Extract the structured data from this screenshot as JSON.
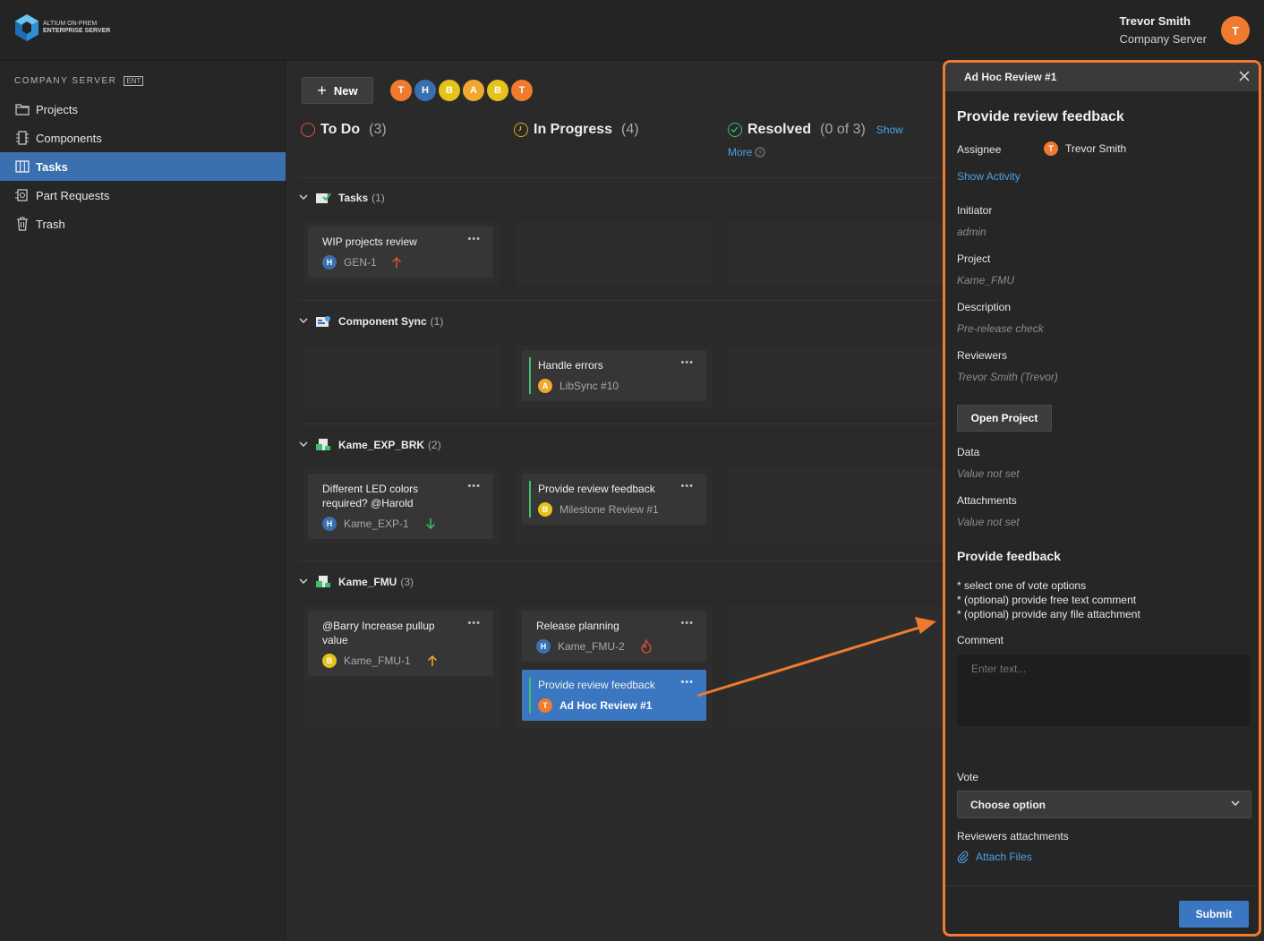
{
  "app": {
    "logo_line1": "ALTIUM ON-PREM",
    "logo_line2": "ENTERPRISE SERVER"
  },
  "user": {
    "name": "Trevor Smith",
    "server": "Company Server",
    "initial": "T"
  },
  "sidebar": {
    "header": "COMPANY SERVER",
    "badge": "ENT",
    "items": [
      {
        "label": "Projects",
        "icon": "folder-icon"
      },
      {
        "label": "Components",
        "icon": "component-icon"
      },
      {
        "label": "Tasks",
        "icon": "board-icon",
        "active": true
      },
      {
        "label": "Part Requests",
        "icon": "part-request-icon"
      },
      {
        "label": "Trash",
        "icon": "trash-icon"
      }
    ]
  },
  "board": {
    "new_label": "New",
    "filter_avatars": [
      {
        "initial": "T",
        "color": "#f07a2e"
      },
      {
        "initial": "H",
        "color": "#3a6fb0"
      },
      {
        "initial": "B",
        "color": "#e6c21a"
      },
      {
        "initial": "A",
        "color": "#f0a830"
      },
      {
        "initial": "B",
        "color": "#e6c21a"
      },
      {
        "initial": "T",
        "color": "#f07a2e"
      }
    ],
    "columns": [
      {
        "title": "To Do",
        "count": "(3)"
      },
      {
        "title": "In Progress",
        "count": "(4)"
      },
      {
        "title": "Resolved",
        "count": "(0 of 3)",
        "link1": "Show",
        "link2": "More"
      }
    ],
    "groups": [
      {
        "name": "Tasks",
        "count": "(1)"
      },
      {
        "name": "Component Sync",
        "count": "(1)"
      },
      {
        "name": "Kame_EXP_BRK",
        "count": "(2)"
      },
      {
        "name": "Kame_FMU",
        "count": "(3)"
      }
    ],
    "cards": {
      "wip": {
        "title": "WIP projects review",
        "avatar": "H",
        "ref": "GEN-1"
      },
      "handle": {
        "title": "Handle errors",
        "avatar": "A",
        "ref": "LibSync #10"
      },
      "led_line1": "Different LED colors",
      "led_line2": "required? @Harold",
      "led": {
        "avatar": "H",
        "ref": "Kame_EXP-1"
      },
      "prf1": {
        "title": "Provide review feedback",
        "avatar": "B",
        "ref": "Milestone Review #1"
      },
      "barry_line1": "@Barry  Increase pullup",
      "barry_line2": "value",
      "barry": {
        "avatar": "B",
        "ref": "Kame_FMU-1"
      },
      "release": {
        "title": "Release planning",
        "avatar": "H",
        "ref": "Kame_FMU-2"
      },
      "prf2": {
        "title": "Provide review feedback",
        "avatar": "T",
        "ref": "Ad Hoc Review #1"
      },
      "dots": "•••"
    }
  },
  "panel": {
    "titlebar": "Ad Hoc Review #1",
    "heading": "Provide review feedback",
    "assignee_label": "Assignee",
    "assignee_name": "Trevor Smith",
    "assignee_initial": "T",
    "show_activity": "Show Activity",
    "initiator_label": "Initiator",
    "initiator_value": "admin",
    "project_label": "Project",
    "project_value": "Kame_FMU",
    "description_label": "Description",
    "description_value": "Pre-release check",
    "reviewers_label": "Reviewers",
    "reviewers_value": "Trevor Smith (Trevor)",
    "open_project": "Open Project",
    "data_label": "Data",
    "data_value": "Value not set",
    "attachments_label": "Attachments",
    "attachments_value": "Value not set",
    "feedback_heading": "Provide feedback",
    "instr1": "* select one of vote options",
    "instr2": "* (optional) provide free text comment",
    "instr3": "* (optional) provide any file attachment",
    "comment_label": "Comment",
    "comment_placeholder": "Enter text...",
    "vote_label": "Vote",
    "vote_selected": "Choose option",
    "reviewers_attachments_label": "Reviewers attachments",
    "attach_files": "Attach Files",
    "submit": "Submit"
  },
  "colors": {
    "accent": "#3a77c0",
    "highlight": "#f07a2e",
    "link": "#4aa3e8",
    "green": "#3fbf6f"
  }
}
